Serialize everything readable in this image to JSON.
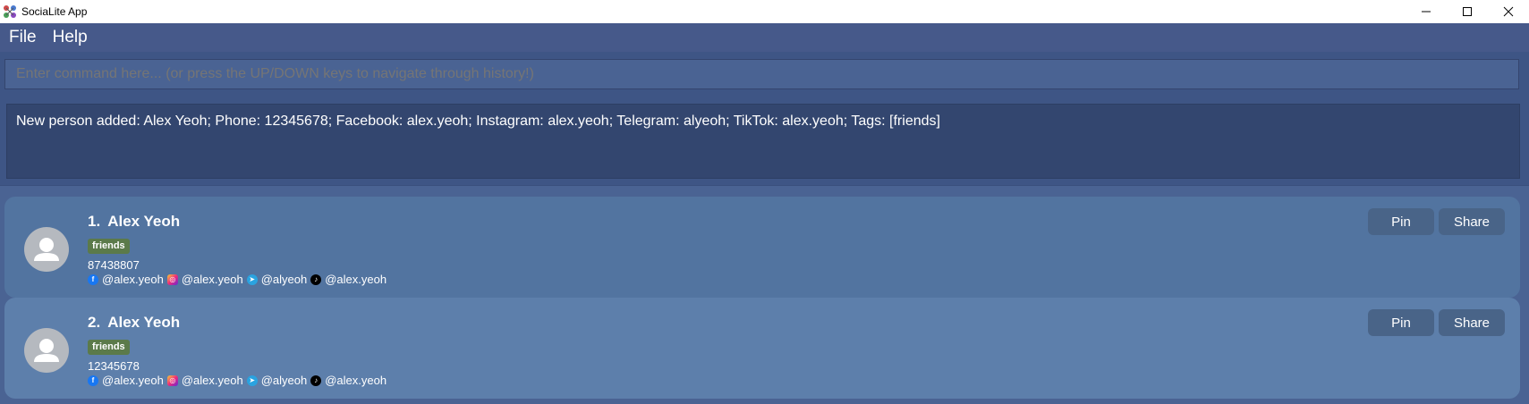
{
  "window": {
    "title": "SociaLite App",
    "controls": [
      "minimize-icon",
      "maximize-icon",
      "close-icon"
    ]
  },
  "menu": {
    "items": [
      {
        "label": "File"
      },
      {
        "label": "Help"
      }
    ]
  },
  "command": {
    "placeholder": "Enter command here... (or press the UP/DOWN keys to navigate through history!)",
    "value": ""
  },
  "result": {
    "text": "New person added: Alex Yeoh; Phone: 12345678; Facebook: alex.yeoh; Instagram: alex.yeoh; Telegram: alyeoh; TikTok: alex.yeoh; Tags: [friends]"
  },
  "persons": [
    {
      "index": "1.",
      "name": "Alex Yeoh",
      "tag": "friends",
      "phone": "87438807",
      "facebook": "@alex.yeoh",
      "instagram": "@alex.yeoh",
      "telegram": "@alyeoh",
      "tiktok": "@alex.yeoh",
      "pin_label": "Pin",
      "share_label": "Share"
    },
    {
      "index": "2.",
      "name": "Alex Yeoh",
      "tag": "friends",
      "phone": "12345678",
      "facebook": "@alex.yeoh",
      "instagram": "@alex.yeoh",
      "telegram": "@alyeoh",
      "tiktok": "@alex.yeoh",
      "pin_label": "Pin",
      "share_label": "Share"
    }
  ],
  "colors": {
    "background": "#3e5585",
    "card_1": "#5274a0",
    "card_2": "#5d7fab",
    "tag": "#5b7a4a",
    "button": "#496488"
  }
}
